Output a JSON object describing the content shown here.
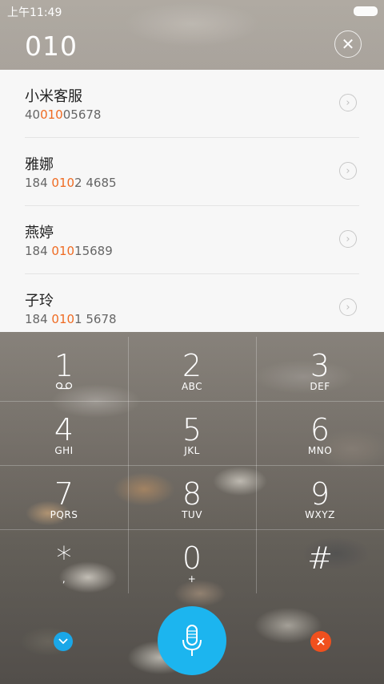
{
  "status_bar": {
    "time": "上午11:49",
    "battery_icon": "battery-icon"
  },
  "search": {
    "number": "010",
    "clear_icon": "close-icon"
  },
  "results": [
    {
      "name": "小米客服",
      "number_pre": "40",
      "number_match": "010",
      "number_post": "05678"
    },
    {
      "name": "雅娜",
      "number_pre": "184 ",
      "number_match": "010",
      "number_post": "2 4685"
    },
    {
      "name": "燕婷",
      "number_pre": "184 ",
      "number_match": "010",
      "number_post": "15689"
    },
    {
      "name": "子玲",
      "number_pre": "184 ",
      "number_match": "010",
      "number_post": "1 5678"
    }
  ],
  "keypad": {
    "keys": [
      {
        "digit": "1",
        "letters": ""
      },
      {
        "digit": "2",
        "letters": "ABC"
      },
      {
        "digit": "3",
        "letters": "DEF"
      },
      {
        "digit": "4",
        "letters": "GHI"
      },
      {
        "digit": "5",
        "letters": "JKL"
      },
      {
        "digit": "6",
        "letters": "MNO"
      },
      {
        "digit": "7",
        "letters": "PQRS"
      },
      {
        "digit": "8",
        "letters": "TUV"
      },
      {
        "digit": "9",
        "letters": "WXYZ"
      },
      {
        "digit": "*",
        "letters": ","
      },
      {
        "digit": "0",
        "letters": "+"
      },
      {
        "digit": "#",
        "letters": ""
      }
    ]
  },
  "bottom_bar": {
    "collapse_icon": "chevron-down-icon",
    "voice_icon": "microphone-icon",
    "delete_icon": "close-icon"
  },
  "colors": {
    "highlight": "#ef6b22",
    "voice_button": "#1cb5ef",
    "collapse_button": "#1aa7e8",
    "delete_button": "#f0501e"
  }
}
